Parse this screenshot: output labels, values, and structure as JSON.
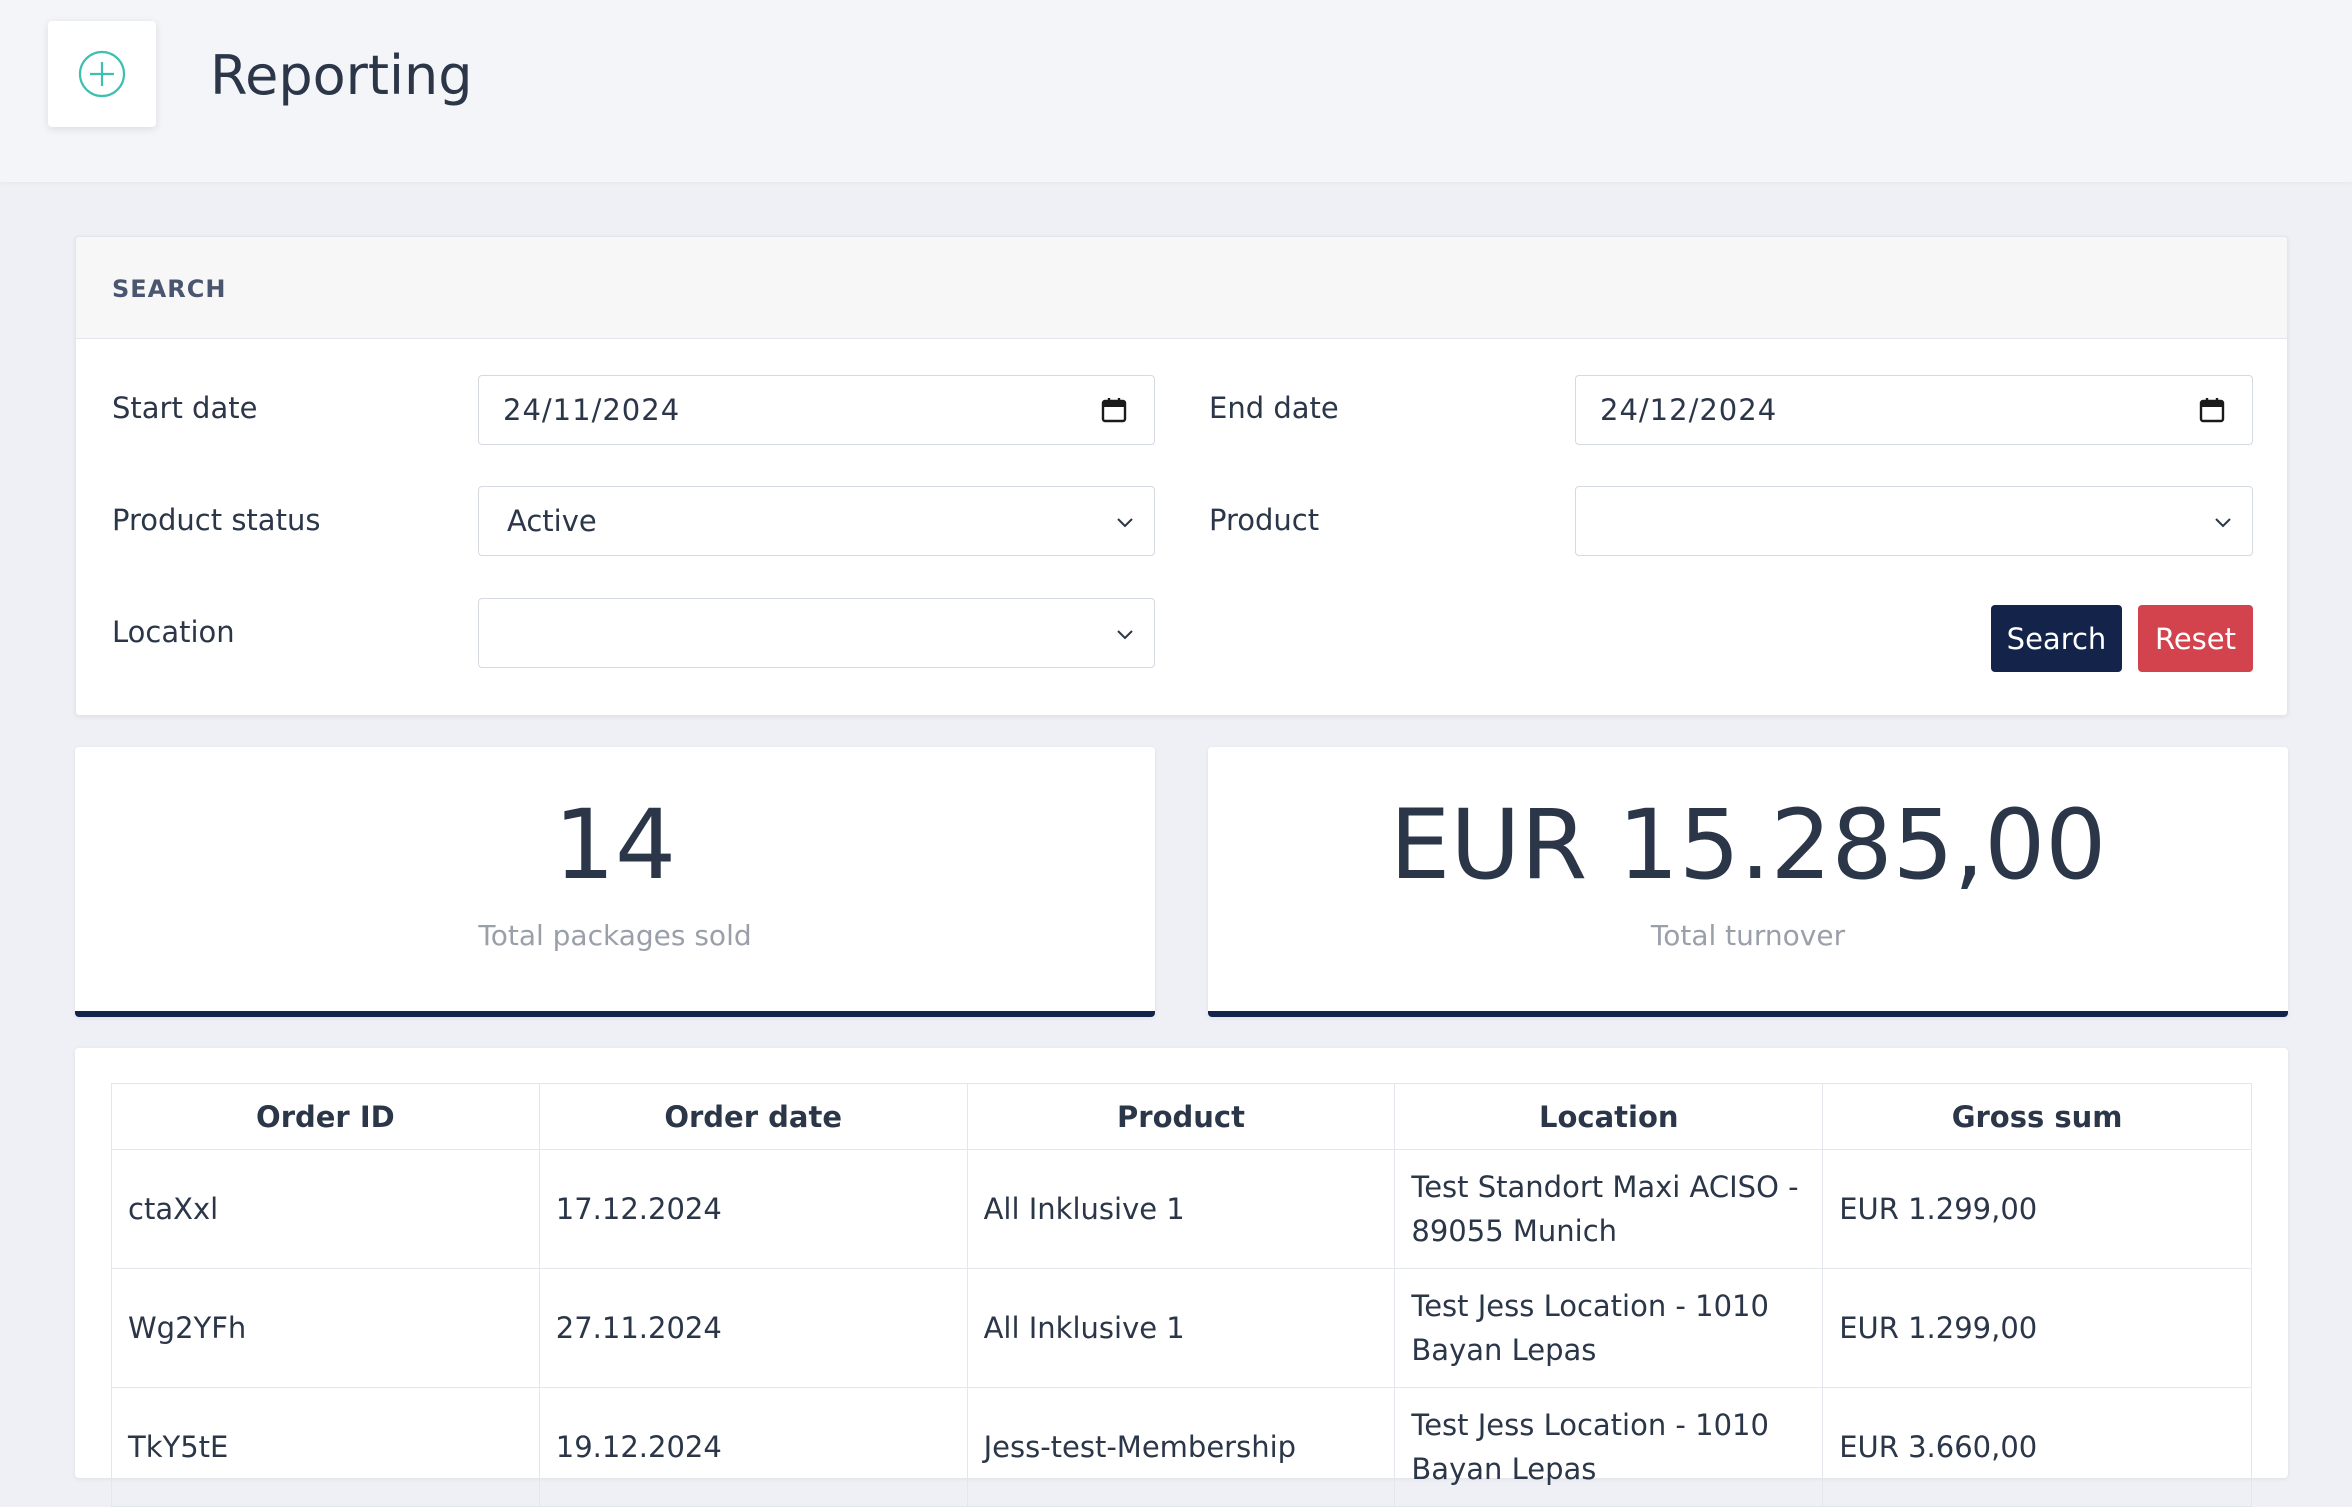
{
  "header": {
    "title": "Reporting",
    "logo_icon": "plus-circle-icon",
    "accent_color": "#3fbfae"
  },
  "search": {
    "heading": "SEARCH",
    "start_date_label": "Start date",
    "start_date_value": "24/11/2024",
    "end_date_label": "End date",
    "end_date_value": "24/12/2024",
    "product_status_label": "Product status",
    "product_status_value": "Active",
    "product_label": "Product",
    "product_value": "",
    "location_label": "Location",
    "location_value": "",
    "search_button": "Search",
    "reset_button": "Reset",
    "search_button_color": "#14234a",
    "reset_button_color": "#d2434d"
  },
  "stats": {
    "packages_value": "14",
    "packages_label": "Total packages sold",
    "turnover_value": "EUR 15.285,00",
    "turnover_label": "Total turnover"
  },
  "orders": {
    "columns": [
      "Order ID",
      "Order date",
      "Product",
      "Location",
      "Gross sum"
    ],
    "rows": [
      [
        "ctaXxl",
        "17.12.2024",
        "All Inklusive 1",
        "Test Standort Maxi ACISO - 89055 Munich",
        "EUR 1.299,00"
      ],
      [
        "Wg2YFh",
        "27.11.2024",
        "All Inklusive 1",
        "Test Jess Location - 1010 Bayan Lepas",
        "EUR 1.299,00"
      ],
      [
        "TkY5tE",
        "19.12.2024",
        "Jess-test-Membership",
        "Test Jess Location - 1010 Bayan Lepas",
        "EUR 3.660,00"
      ]
    ]
  }
}
